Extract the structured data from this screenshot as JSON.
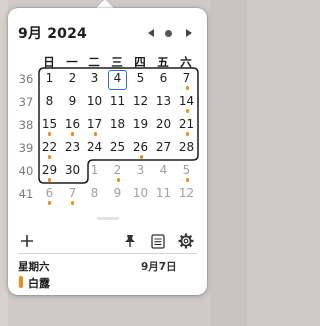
{
  "calendar": {
    "title": "9月 2024",
    "weekday_headers": [
      "日",
      "一",
      "二",
      "三",
      "四",
      "五",
      "六"
    ],
    "week_numbers": [
      "36",
      "37",
      "38",
      "39",
      "40",
      "41"
    ],
    "weeks": [
      [
        "1",
        "2",
        "3",
        "4",
        "5",
        "6",
        "7"
      ],
      [
        "8",
        "9",
        "10",
        "11",
        "12",
        "13",
        "14"
      ],
      [
        "15",
        "16",
        "17",
        "18",
        "19",
        "20",
        "21"
      ],
      [
        "22",
        "23",
        "24",
        "25",
        "26",
        "27",
        "28"
      ],
      [
        "29",
        "30",
        "1",
        "2",
        "3",
        "4",
        "5"
      ],
      [
        "6",
        "7",
        "8",
        "9",
        "10",
        "11",
        "12"
      ]
    ],
    "today": "4"
  },
  "icons": {
    "prev": "chevron-left-icon",
    "today": "today-dot-icon",
    "next": "chevron-right-icon",
    "add": "plus-icon",
    "pin": "pin-icon",
    "agenda": "list-icon",
    "settings": "gear-icon"
  },
  "footer": {
    "selected_weekday": "星期六",
    "selected_date": "9月7日",
    "event_label": "白露"
  },
  "colors": {
    "accent": "#2b6fd6",
    "event": "#f08c13"
  }
}
